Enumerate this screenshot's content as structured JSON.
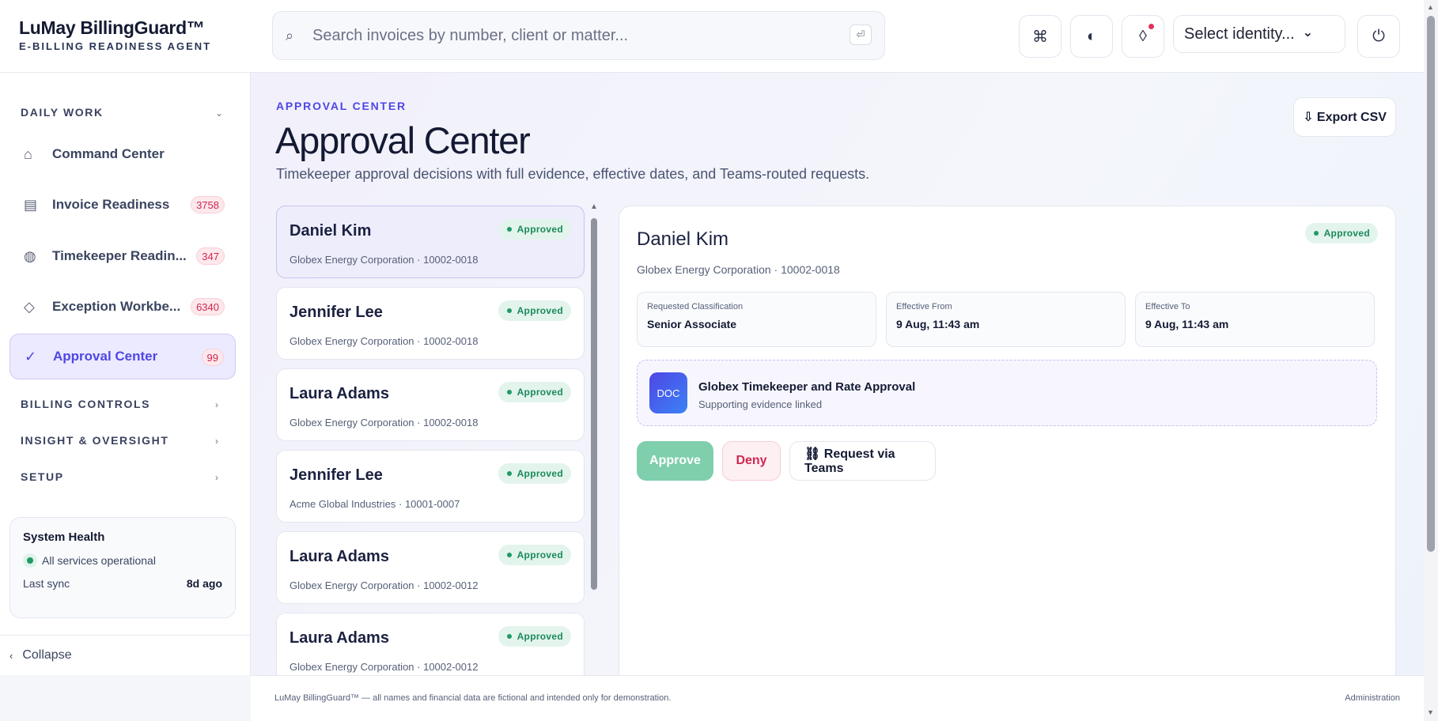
{
  "brand": {
    "name": "LuMay BillingGuard™",
    "subtitle": "E-BILLING READINESS AGENT"
  },
  "search": {
    "placeholder": "Search invoices by number, client or matter..."
  },
  "topbar": {
    "icons": [
      "command-icon",
      "contrast-icon",
      "notification-icon",
      "power-icon"
    ],
    "identity_select": "Select identity..."
  },
  "sidebar": {
    "sections": [
      {
        "label": "DAILY WORK",
        "expanded": true
      },
      {
        "label": "BILLING CONTROLS",
        "expanded": false
      },
      {
        "label": "INSIGHT & OVERSIGHT",
        "expanded": false
      },
      {
        "label": "SETUP",
        "expanded": false
      }
    ],
    "items": [
      {
        "label": "Command Center",
        "icon": "⌂",
        "badge": ""
      },
      {
        "label": "Invoice Readiness",
        "icon": "▤",
        "badge": "3758"
      },
      {
        "label": "Timekeeper Readin...",
        "icon": "◍",
        "badge": "347"
      },
      {
        "label": "Exception Workbe...",
        "icon": "◇",
        "badge": "6340"
      },
      {
        "label": "Approval Center",
        "icon": "✓",
        "badge": "99",
        "active": true
      }
    ],
    "health": {
      "title": "System Health",
      "status": "All services operational",
      "sync_label": "Last sync",
      "sync_value": "8d ago"
    },
    "collapse": "Collapse"
  },
  "page": {
    "eyebrow": "APPROVAL CENTER",
    "title": "Approval Center",
    "subtitle": "Timekeeper approval decisions with full evidence, effective dates, and Teams-routed requests.",
    "export": "⇩ Export CSV"
  },
  "requests": [
    {
      "name": "Daniel Kim",
      "client": "Globex Energy Corporation · 10002-0018",
      "status": "Approved"
    },
    {
      "name": "Jennifer Lee",
      "client": "Globex Energy Corporation · 10002-0018",
      "status": "Approved"
    },
    {
      "name": "Laura Adams",
      "client": "Globex Energy Corporation · 10002-0018",
      "status": "Approved"
    },
    {
      "name": "Jennifer Lee",
      "client": "Acme Global Industries · 10001-0007",
      "status": "Approved"
    },
    {
      "name": "Laura Adams",
      "client": "Globex Energy Corporation · 10002-0012",
      "status": "Approved"
    },
    {
      "name": "Laura Adams",
      "client": "Globex Energy Corporation · 10002-0012",
      "status": "Approved"
    }
  ],
  "detail": {
    "name": "Daniel Kim",
    "client": "Globex Energy Corporation · 10002-0018",
    "status": "Approved",
    "fields": [
      {
        "label": "Requested Classification",
        "value": "Senior Associate"
      },
      {
        "label": "Effective From",
        "value": "9 Aug, 11:43 am"
      },
      {
        "label": "Effective To",
        "value": "9 Aug, 11:43 am"
      }
    ],
    "evidence": {
      "icon_text": "DOC",
      "title": "Globex Timekeeper and Rate Approval",
      "subtitle": "Supporting evidence linked"
    },
    "actions": {
      "approve": "Approve",
      "deny": "Deny",
      "teams": "⛓ Request via Teams"
    }
  },
  "footer": {
    "disclaimer": "LuMay BillingGuard™ — all names and financial data are fictional and intended only for demonstration.",
    "link": "Administration"
  },
  "colors": {
    "accent": "#4f46e5",
    "approved": "#1a8a5c",
    "badge": "#d02750"
  }
}
